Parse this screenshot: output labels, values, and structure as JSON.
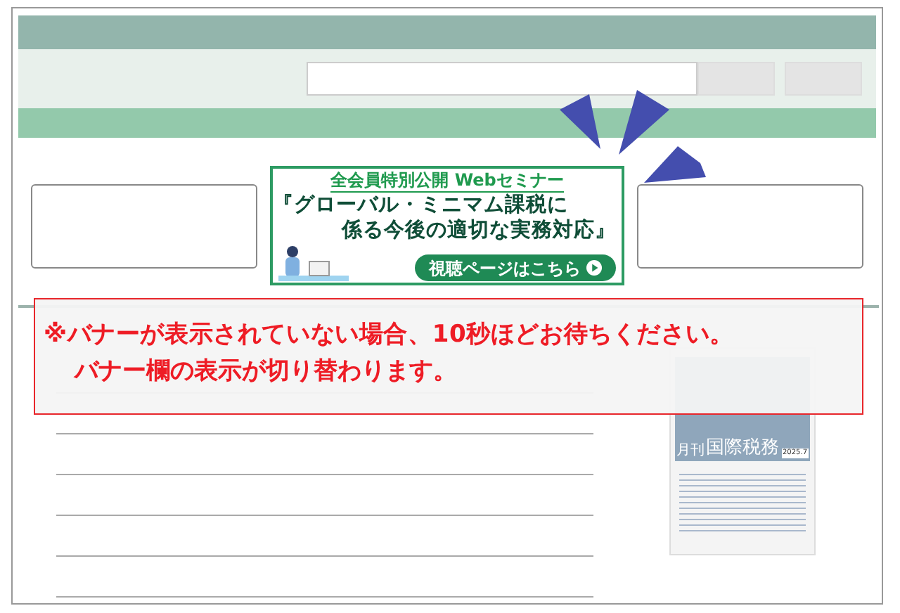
{
  "banner": {
    "headline": "全会員特別公開 Webセミナー",
    "title_line_1": "『グローバル・ミニマム課税に",
    "title_line_2": "係る今後の適切な実務対応』",
    "button": "視聴ページはこちら"
  },
  "notice": {
    "line_1": "※バナーが表示されていない場合、10秒ほどお待ちください。",
    "line_2": "バナー欄の表示が切り替わります。"
  },
  "magazine": {
    "prefix": "月刊",
    "title": "国際税務",
    "issue": "2025.7"
  }
}
